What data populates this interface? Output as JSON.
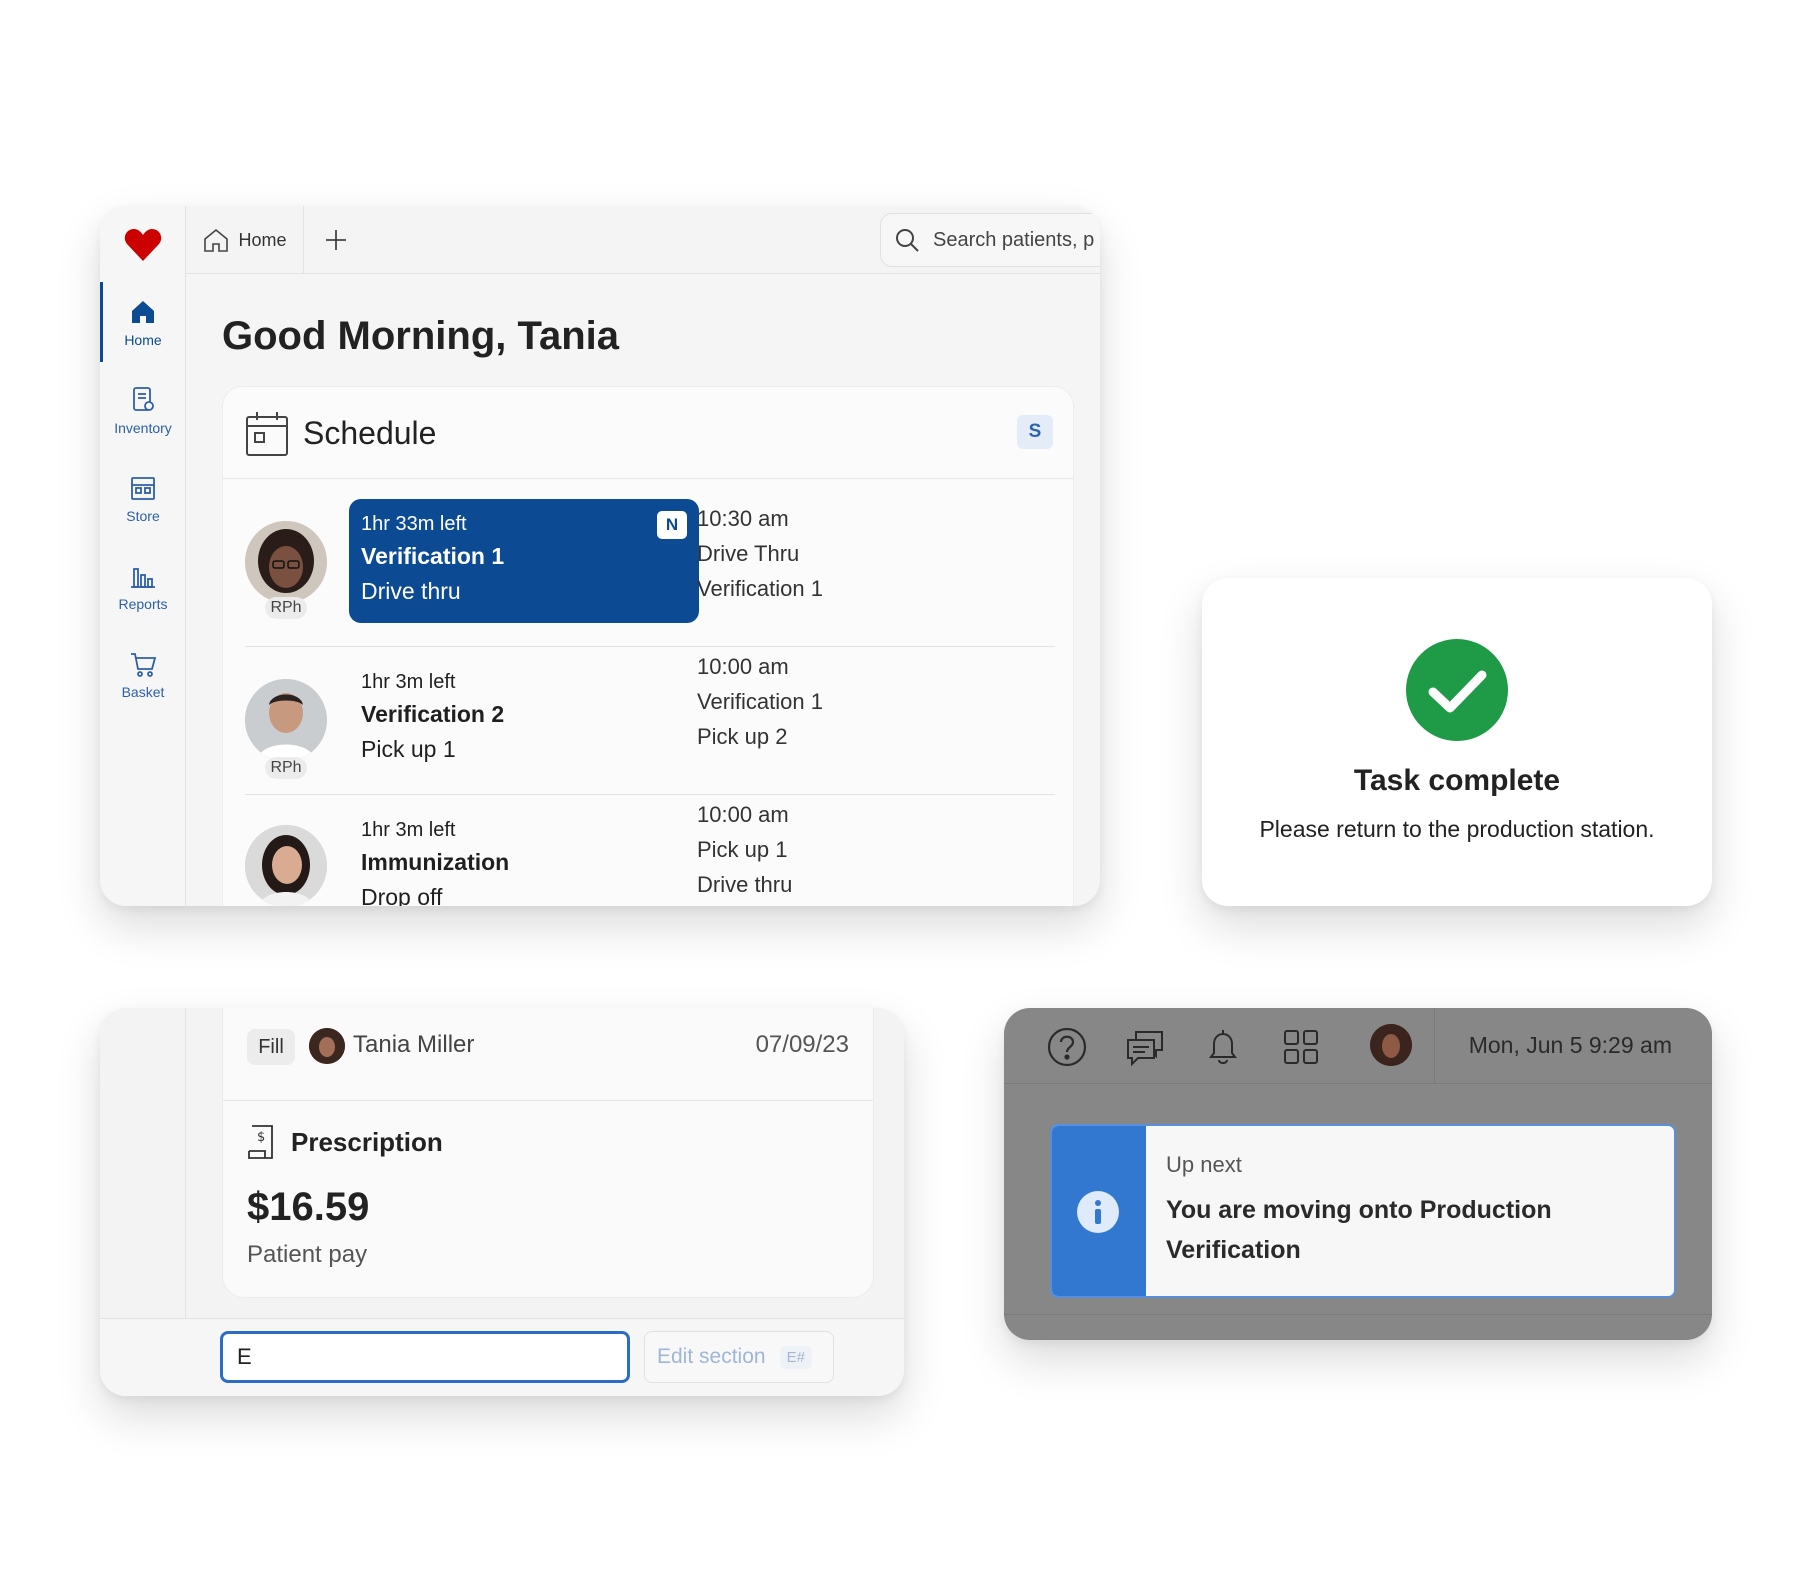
{
  "home": {
    "tab_label": "Home",
    "search_placeholder": "Search patients, p",
    "greeting": "Good Morning, Tania",
    "sidebar": [
      {
        "label": "Home",
        "icon": "home-icon"
      },
      {
        "label": "Inventory",
        "icon": "inventory-icon"
      },
      {
        "label": "Store",
        "icon": "store-icon"
      },
      {
        "label": "Reports",
        "icon": "reports-icon"
      },
      {
        "label": "Basket",
        "icon": "basket-icon"
      }
    ],
    "schedule": {
      "title": "Schedule",
      "shortcut_key": "S",
      "rows": [
        {
          "role": "RPh",
          "time_left": "1hr 33m left",
          "title": "Verification 1",
          "subtitle": "Drive thru",
          "badge": "N",
          "time": "10:30 am",
          "meta1": "Drive Thru",
          "meta2": "Verification 1"
        },
        {
          "role": "RPh",
          "time_left": "1hr 3m left",
          "title": "Verification 2",
          "subtitle": "Pick up 1",
          "time": "10:00 am",
          "meta1": "Verification 1",
          "meta2": "Pick up 2"
        },
        {
          "time_left": "1hr 3m left",
          "title": "Immunization",
          "subtitle": "Drop off",
          "time": "10:00 am",
          "meta1": "Pick up 1",
          "meta2": "Drive thru"
        }
      ]
    }
  },
  "task_complete": {
    "title": "Task complete",
    "message": "Please return to the production station."
  },
  "prescription": {
    "fill_label": "Fill",
    "user_name": "Tania Miller",
    "date": "07/09/23",
    "title": "Prescription",
    "amount": "$16.59",
    "amount_label": "Patient pay",
    "input_value": "E",
    "edit_label": "Edit section",
    "edit_shortcut": "E#"
  },
  "up_next": {
    "datetime": "Mon, Jun 5 9:29 am",
    "label": "Up next",
    "message": "You are moving onto Production Verification"
  },
  "colors": {
    "brand_red": "#cc0000",
    "primary_blue": "#0c4b93",
    "success_green": "#1f9a47",
    "info_blue": "#3278d0"
  }
}
